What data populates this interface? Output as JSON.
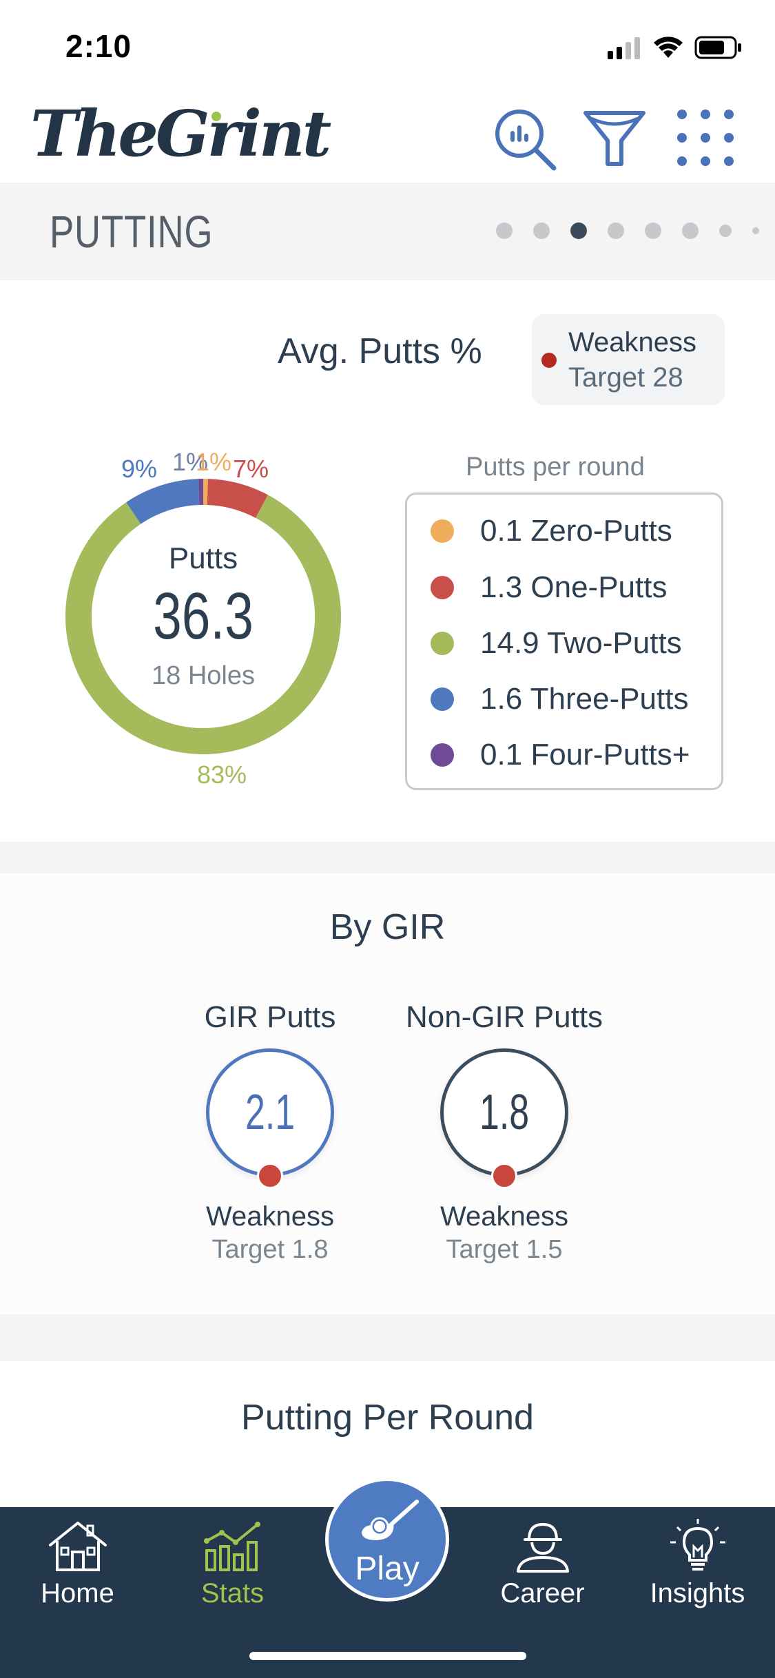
{
  "status": {
    "time": "2:10"
  },
  "header": {
    "logo": "TheGrint",
    "icons": [
      "stats-search-icon",
      "filter-icon",
      "apps-grid-icon"
    ]
  },
  "section": {
    "title": "PUTTING",
    "page_index": 3,
    "page_count": 8
  },
  "avg_putts": {
    "title": "Avg. Putts %",
    "badge": {
      "label": "Weakness",
      "target": "Target 28",
      "color": "#b52a1e"
    },
    "donut": {
      "center_label": "Putts",
      "center_value": "36.3",
      "center_sub": "18 Holes",
      "pct_labels": {
        "four": "1%",
        "zero": "1%",
        "one": "7%",
        "three": "9%",
        "two": "83%"
      }
    },
    "legend_title": "Putts per round",
    "legend": [
      {
        "text": "0.1 Zero-Putts",
        "color": "#efad5c"
      },
      {
        "text": "1.3 One-Putts",
        "color": "#c9504a"
      },
      {
        "text": "14.9 Two-Putts",
        "color": "#a4ba5b"
      },
      {
        "text": "1.6 Three-Putts",
        "color": "#5078bf"
      },
      {
        "text": "0.1 Four-Putts+",
        "color": "#6f4a95"
      }
    ]
  },
  "chart_data": {
    "type": "pie",
    "categories": [
      "Zero-Putts",
      "One-Putts",
      "Two-Putts",
      "Three-Putts",
      "Four-Putts+"
    ],
    "values": [
      0.1,
      1.3,
      14.9,
      1.6,
      0.1
    ],
    "percent_labels": [
      "1%",
      "7%",
      "83%",
      "9%",
      "1%"
    ],
    "colors": [
      "#efad5c",
      "#c9504a",
      "#a4ba5b",
      "#5078bf",
      "#6f4a95"
    ],
    "title": "Avg. Putts %"
  },
  "by_gir": {
    "title": "By GIR",
    "items": [
      {
        "label": "GIR Putts",
        "value": "2.1",
        "status": "Weakness",
        "target": "Target 1.8",
        "ring_color": "#5078bf",
        "value_color": "#4a70b5"
      },
      {
        "label": "Non-GIR Putts",
        "value": "1.8",
        "status": "Weakness",
        "target": "Target 1.5",
        "ring_color": "#3a4e60",
        "value_color": "#2f4052"
      }
    ]
  },
  "putting_per_round": {
    "title": "Putting Per Round"
  },
  "nav": {
    "items": [
      {
        "label": "Home",
        "icon": "home-icon"
      },
      {
        "label": "Stats",
        "icon": "stats-chart-icon",
        "active": true
      },
      {
        "label": "Play",
        "icon": "golf-club-icon"
      },
      {
        "label": "Career",
        "icon": "career-golfer-icon"
      },
      {
        "label": "Insights",
        "icon": "lightbulb-icon"
      }
    ]
  }
}
